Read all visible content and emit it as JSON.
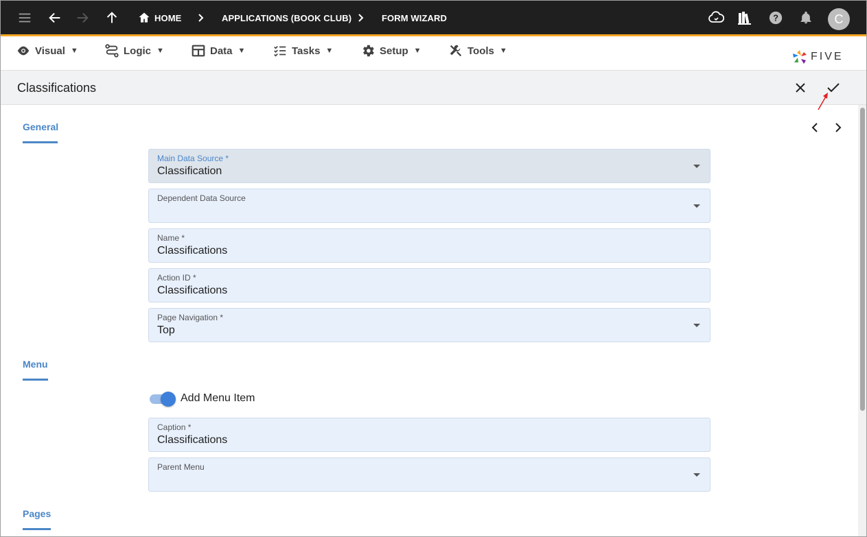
{
  "topbar": {
    "breadcrumbs": [
      {
        "label": "HOME"
      },
      {
        "label": "APPLICATIONS (BOOK CLUB)"
      },
      {
        "label": "FORM WIZARD"
      }
    ],
    "avatar_initial": "C",
    "icons": [
      "menu-icon",
      "back-arrow-icon",
      "forward-arrow-icon",
      "up-arrow-icon",
      "home-icon",
      "cloud-deploy-icon",
      "library-icon",
      "help-icon",
      "notifications-icon"
    ]
  },
  "menubar": {
    "items": [
      {
        "label": "Visual",
        "icon": "eye-icon"
      },
      {
        "label": "Logic",
        "icon": "logic-icon"
      },
      {
        "label": "Data",
        "icon": "table-icon"
      },
      {
        "label": "Tasks",
        "icon": "tasks-icon"
      },
      {
        "label": "Setup",
        "icon": "gear-icon"
      },
      {
        "label": "Tools",
        "icon": "tools-icon"
      }
    ],
    "caret": "▼",
    "logo_text": "FIVE"
  },
  "titlebar": {
    "title": "Classifications"
  },
  "sections": {
    "general": "General",
    "menu": "Menu",
    "pages": "Pages"
  },
  "fields": {
    "main_data_source": {
      "label": "Main Data Source *",
      "value": "Classification"
    },
    "dependent_data_source": {
      "label": "Dependent Data Source",
      "value": ""
    },
    "name": {
      "label": "Name *",
      "value": "Classifications"
    },
    "action_id": {
      "label": "Action ID *",
      "value": "Classifications"
    },
    "page_navigation": {
      "label": "Page Navigation *",
      "value": "Top"
    },
    "caption": {
      "label": "Caption *",
      "value": "Classifications"
    },
    "parent_menu": {
      "label": "Parent Menu",
      "value": ""
    }
  },
  "toggle": {
    "label": "Add Menu Item",
    "checked": true
  },
  "colors": {
    "topbar_bg": "#1f1f1f",
    "accent_orange": "#f5a623",
    "section_blue": "#4a86c8",
    "field_bg": "#e8f0fc",
    "toggle_blue": "#3d7fd9",
    "annotation_red": "#e02020"
  }
}
